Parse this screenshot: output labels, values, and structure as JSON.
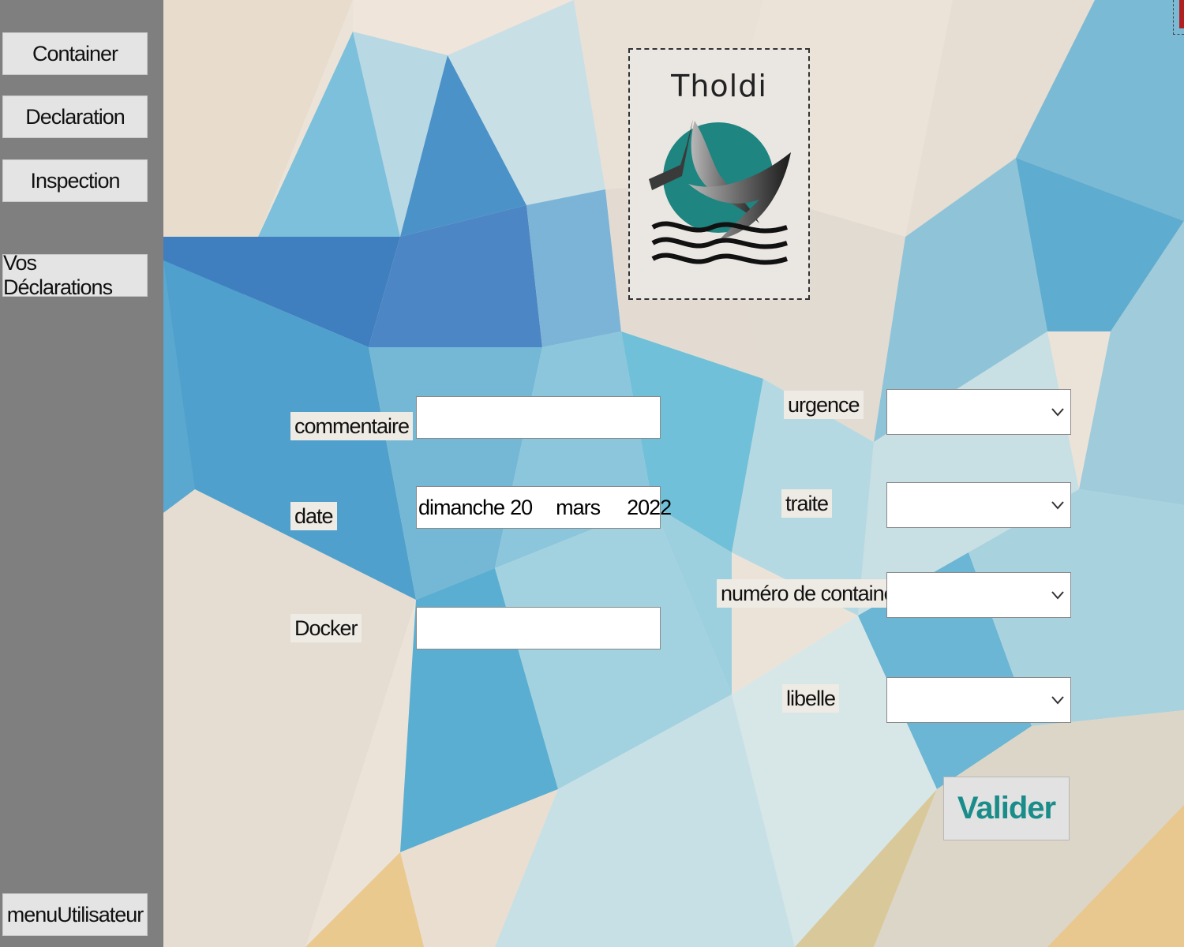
{
  "sidebar": {
    "items": [
      {
        "label": "Container"
      },
      {
        "label": "Declaration"
      },
      {
        "label": "Inspection"
      },
      {
        "label": "Vos Déclarations"
      }
    ],
    "footer_label": "menuUtilisateur"
  },
  "logo": {
    "title": "Tholdi"
  },
  "form": {
    "commentaire": {
      "label": "commentaire",
      "value": ""
    },
    "date": {
      "label": "date",
      "day_name": "dimanche",
      "day": "20",
      "month": "mars",
      "year": "2022"
    },
    "docker": {
      "label": "Docker",
      "value": ""
    },
    "urgence": {
      "label": "urgence",
      "value": ""
    },
    "traite": {
      "label": "traite",
      "value": ""
    },
    "numero_container": {
      "label": "numéro de container",
      "value": ""
    },
    "libelle": {
      "label": "libelle",
      "value": ""
    },
    "submit_label": "Valider"
  },
  "colors": {
    "sidebar_bg": "#7f7f7f",
    "accent": "#1a8c8a"
  },
  "icons": [
    "chevron-down-icon",
    "whale-logo-icon"
  ]
}
